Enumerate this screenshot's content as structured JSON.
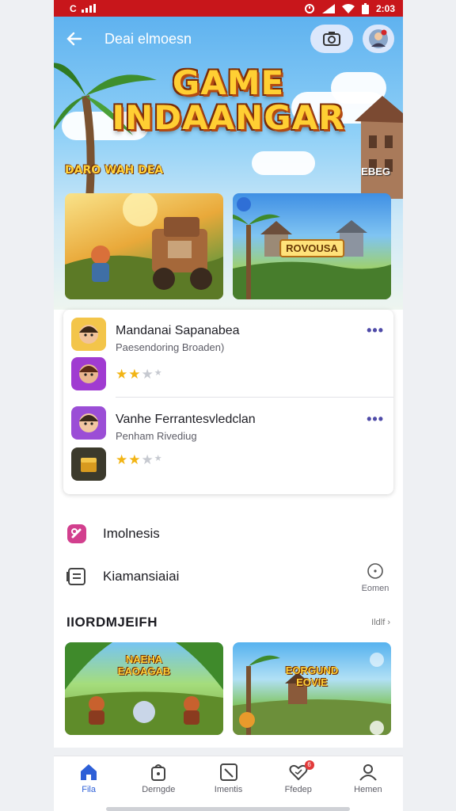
{
  "status_bar": {
    "left_text": "C",
    "right_text": "2:03"
  },
  "app_bar": {
    "title": "Deai elmoesn"
  },
  "hero": {
    "title_line1": "GAME",
    "title_line2": "INDAANGAR",
    "tag_left": "DARO WAH DEA",
    "tag_right": "EBEG"
  },
  "cards": [
    {
      "label": ""
    },
    {
      "label": "ROVOUSA"
    }
  ],
  "list": [
    {
      "title": "Mandanai Sapanabea",
      "subtitle": "Paesendoring Broaden)",
      "rating": 2.5
    },
    {
      "title": "Vanhe Ferrantesvledclan",
      "subtitle": "Penham Rivediug",
      "rating": 2.5
    }
  ],
  "menu": [
    {
      "label": "Imolnesis",
      "icon": "heart-tag-icon",
      "right": ""
    },
    {
      "label": "Kiamansiaiai",
      "icon": "notes-icon",
      "right": "Eomen"
    }
  ],
  "section": {
    "title": "IIORDMJEIFH",
    "more": "Ildlf"
  },
  "bottom_cards": [
    {
      "label_line1": "NAEHA",
      "label_line2": "EAOAGAB"
    },
    {
      "label_line1": "EORGUND",
      "label_line2": "EOVIE"
    }
  ],
  "bottom_nav": [
    {
      "label": "Fila",
      "icon": "home-icon",
      "active": true
    },
    {
      "label": "Derngde",
      "icon": "bag-icon",
      "active": false
    },
    {
      "label": "Imentis",
      "icon": "pen-square-icon",
      "active": false
    },
    {
      "label": "Ffedep",
      "icon": "heart-badge-icon",
      "active": false,
      "badge": "6"
    },
    {
      "label": "Hemen",
      "icon": "person-icon",
      "active": false
    }
  ],
  "colors": {
    "status_bar": "#c8161b",
    "accent": "#2d5fd7",
    "star": "#f2b414"
  }
}
